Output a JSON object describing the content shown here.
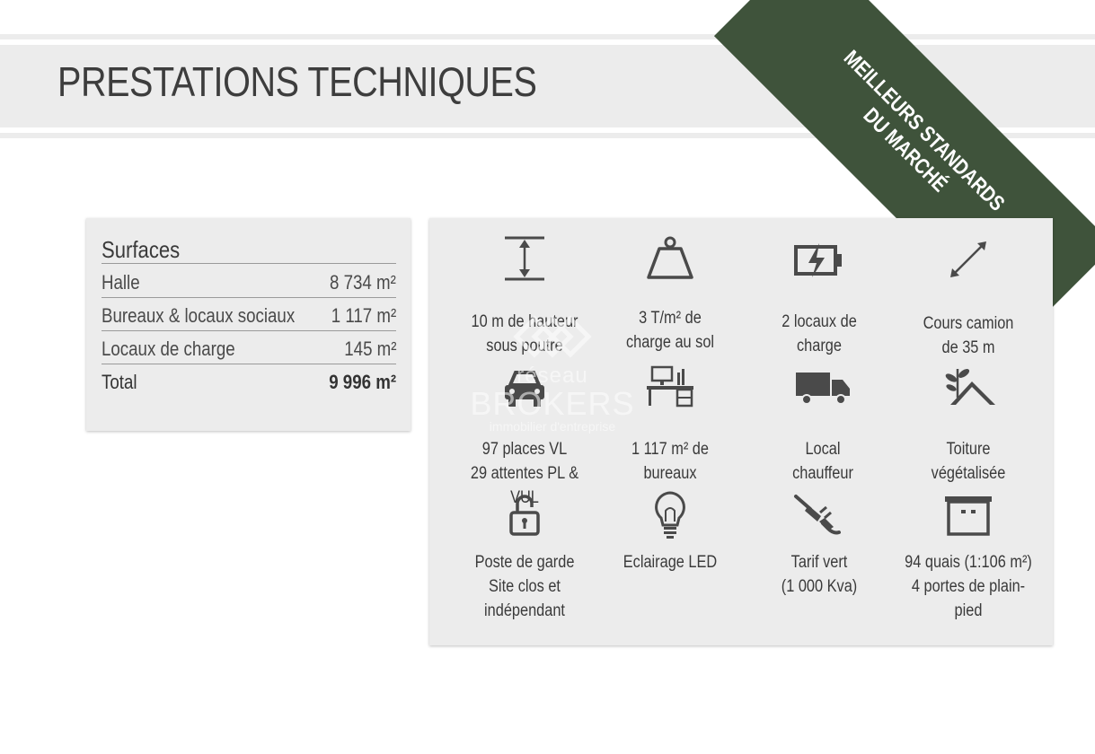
{
  "header": {
    "title": "PRESTATIONS TECHNIQUES"
  },
  "ribbon": {
    "line1": "MEILLEURS STANDARDS",
    "line2": "DU MARCHÉ"
  },
  "surfaces": {
    "title": "Surfaces",
    "rows": [
      {
        "label": "Halle",
        "value": "8 734 m²"
      },
      {
        "label": "Bureaux & locaux sociaux",
        "value": "1 117 m²"
      },
      {
        "label": "Locaux de charge",
        "value": "145 m²"
      }
    ],
    "total": {
      "label": "Total",
      "value": "9 996 m²"
    }
  },
  "features": [
    {
      "icon": "height-arrow-icon",
      "line1": "10 m de hauteur",
      "line2": "sous poutre"
    },
    {
      "icon": "weight-icon",
      "line1": "3 T/m² de",
      "line2": "charge au sol"
    },
    {
      "icon": "battery-charging-icon",
      "line1": "2 locaux de",
      "line2": "charge"
    },
    {
      "icon": "diagonal-arrow-icon",
      "line1": "Cours camion",
      "line2": "de 35 m"
    },
    {
      "icon": "car-icon",
      "line1": "97 places VL",
      "line2": "29 attentes PL & VUL"
    },
    {
      "icon": "desk-icon",
      "line1": "1 117 m² de",
      "line2": "bureaux"
    },
    {
      "icon": "truck-icon",
      "line1": "Local",
      "line2": "chauffeur"
    },
    {
      "icon": "green-roof-icon",
      "line1": "Toiture",
      "line2": "végétalisée"
    },
    {
      "icon": "padlock-icon",
      "line1": "Poste de garde",
      "line2": "Site clos et indépendant"
    },
    {
      "icon": "lightbulb-icon",
      "line1": "Eclairage LED",
      "line2": ""
    },
    {
      "icon": "plug-icon",
      "line1": "Tarif vert",
      "line2": "(1 000 Kva)"
    },
    {
      "icon": "loading-dock-icon",
      "line1": "94 quais (1:106 m²)",
      "line2": "4 portes de plain-pied"
    }
  ],
  "watermark": {
    "top": "réseau",
    "brand": "BROKERS",
    "sub": "immobilier d'entreprise"
  },
  "colors": {
    "ribbon": "#3f533b",
    "icon": "#4a4a4a",
    "panel": "#ececec"
  }
}
